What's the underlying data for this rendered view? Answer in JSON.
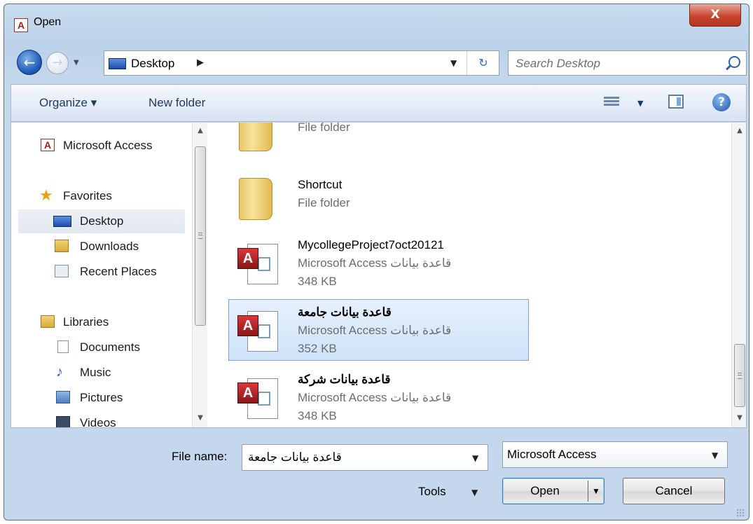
{
  "window": {
    "title": "Open",
    "app_icon_letter": "A",
    "close_glyph": "X"
  },
  "navigation": {
    "back_glyph": "←",
    "forward_glyph": "→",
    "history_glyph": "▼",
    "address": "Desktop",
    "address_sep": "▶",
    "address_drop": "▼",
    "refresh_glyph": "↻",
    "search_placeholder": "Search Desktop"
  },
  "toolbar": {
    "organize_label": "Organize ▾",
    "new_folder_label": "New folder",
    "views_drop": "▼",
    "help_glyph": "?"
  },
  "sidebar": {
    "items": [
      {
        "label": "Microsoft Access",
        "icon": "access-icon"
      },
      {
        "label": "Favorites",
        "icon": "star-icon"
      },
      {
        "label": "Desktop",
        "icon": "desktop-icon",
        "selected": true
      },
      {
        "label": "Downloads",
        "icon": "downloads-icon"
      },
      {
        "label": "Recent Places",
        "icon": "recent-places-icon"
      },
      {
        "label": "Libraries",
        "icon": "libraries-icon"
      },
      {
        "label": "Documents",
        "icon": "documents-icon"
      },
      {
        "label": "Music",
        "icon": "music-icon"
      },
      {
        "label": "Pictures",
        "icon": "pictures-icon"
      },
      {
        "label": "Videos",
        "icon": "videos-icon"
      }
    ]
  },
  "files": [
    {
      "name": "",
      "type": "File folder",
      "size": "",
      "kind": "folder-partial"
    },
    {
      "name": "Shortcut",
      "type": "File folder",
      "size": "",
      "kind": "folder"
    },
    {
      "name": "MycollegeProject7oct20121",
      "type": "Microsoft Access قاعدة بيانات",
      "size": "348 KB",
      "kind": "access"
    },
    {
      "name": "قاعدة بيانات جامعة",
      "type": "Microsoft Access قاعدة بيانات",
      "size": "352 KB",
      "kind": "access",
      "selected": true
    },
    {
      "name": "قاعدة بيانات شركة",
      "type": "Microsoft Access قاعدة بيانات",
      "size": "348 KB",
      "kind": "access"
    }
  ],
  "bottom": {
    "file_name_label": "File name:",
    "file_name_value": "قاعدة بيانات جامعة",
    "file_type_value": "Microsoft Access",
    "tools_label": "Tools",
    "tools_drop": "▼",
    "open_label": "Open",
    "open_drop": "▼",
    "cancel_label": "Cancel"
  },
  "colors": {
    "selection": "#cfe3f8",
    "selection_border": "#7da2ce",
    "access_red": "#c0272d",
    "chrome": "#c4d7ec"
  }
}
